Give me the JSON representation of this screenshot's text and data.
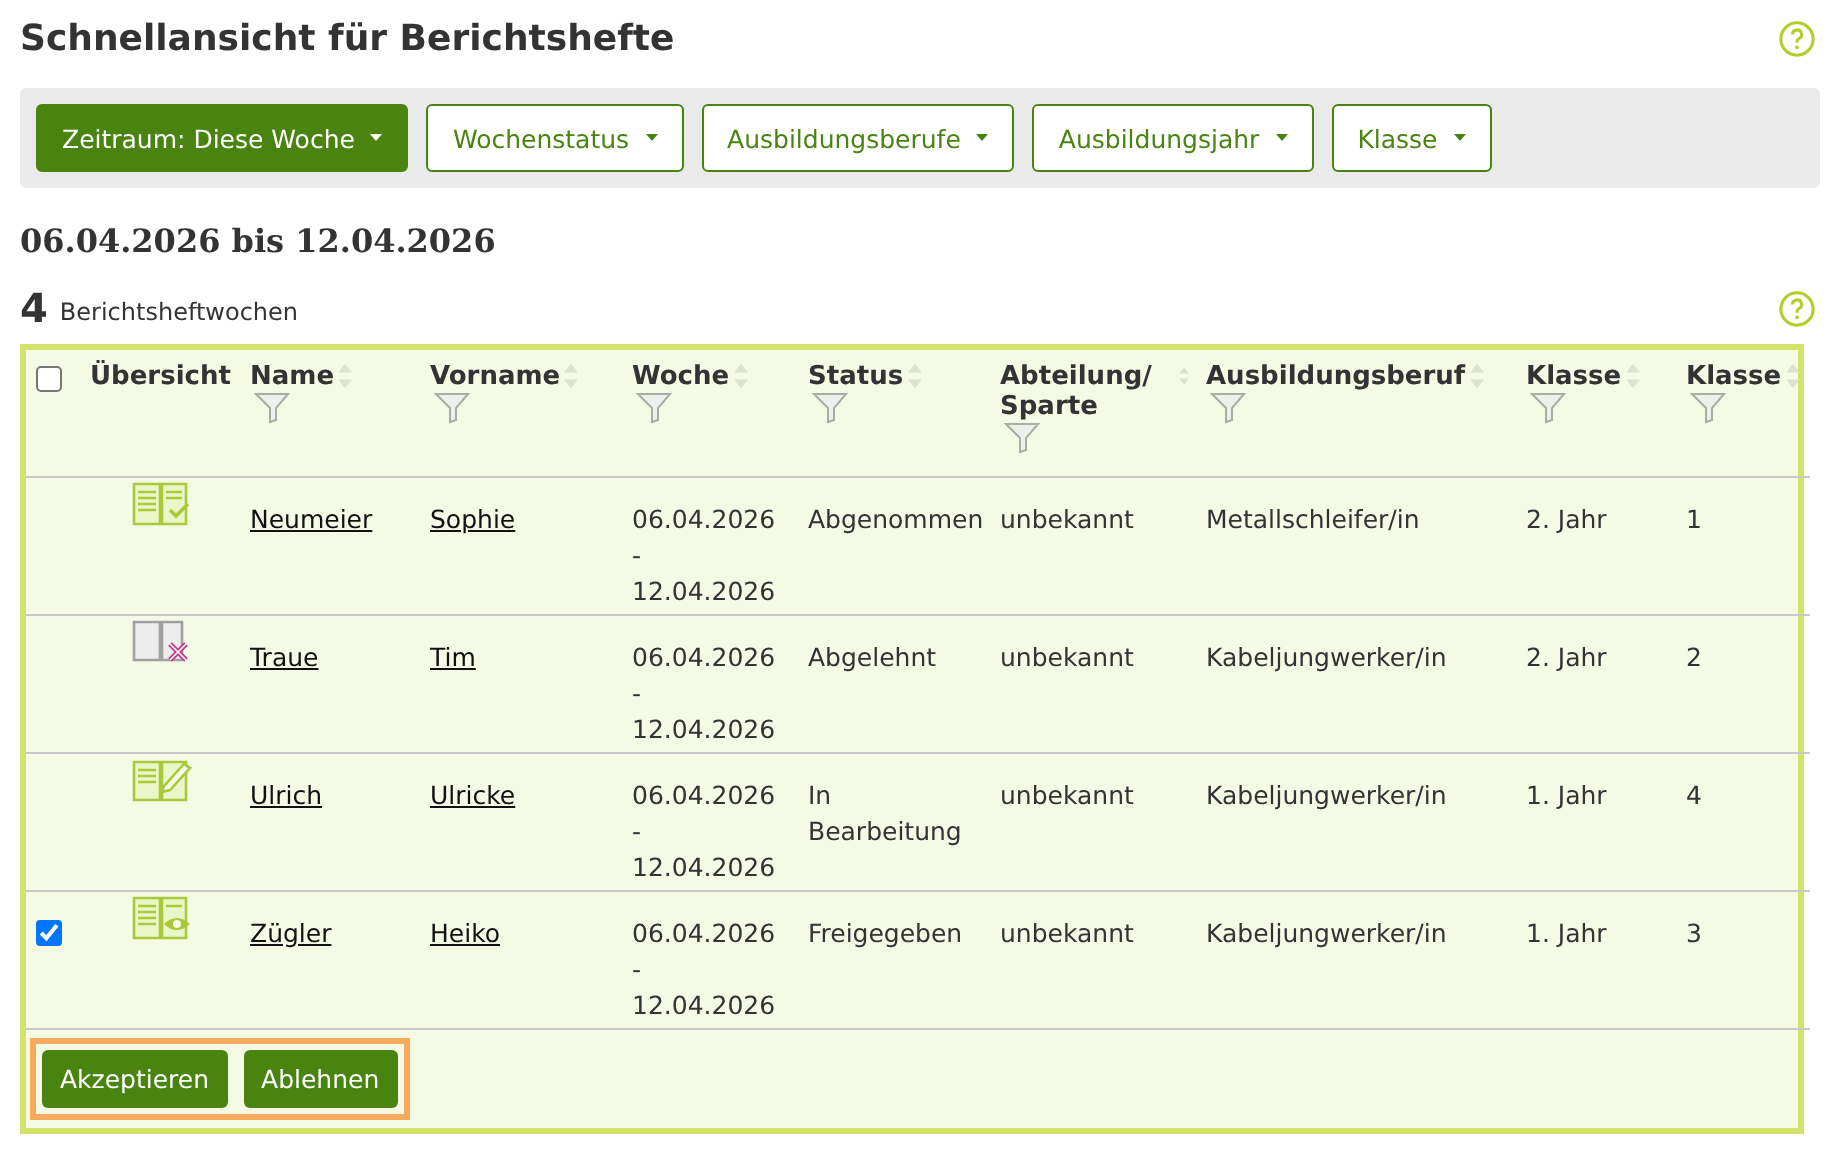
{
  "title": "Schnellansicht für Berichtshefte",
  "filters": [
    {
      "label": "Zeitraum: Diese Woche",
      "selected": true
    },
    {
      "label": "Wochenstatus",
      "selected": false
    },
    {
      "label": "Ausbildungsberufe",
      "selected": false
    },
    {
      "label": "Ausbildungsjahr",
      "selected": false
    },
    {
      "label": "Klasse",
      "selected": false
    }
  ],
  "date_range": "06.04.2026 bis 12.04.2026",
  "count": "4",
  "count_label": "Berichtsheftwochen",
  "table": {
    "select_all_checked": false,
    "columns": [
      {
        "label": "Übersicht",
        "kind": "plain"
      },
      {
        "label": "Name",
        "kind": "sortable"
      },
      {
        "label": "Vorname",
        "kind": "sortable"
      },
      {
        "label": "Woche",
        "kind": "sortable"
      },
      {
        "label": "Status",
        "kind": "sortable"
      },
      {
        "label": "Abteilung/ Sparte",
        "kind": "sortable"
      },
      {
        "label": "Ausbildungsberuf",
        "kind": "sortable"
      },
      {
        "label": "Klasse",
        "kind": "sortable"
      },
      {
        "label": "Klasse",
        "kind": "sortable"
      }
    ],
    "rows": [
      {
        "checked": false,
        "kind": "accepted",
        "name": "Neumeier",
        "vorname": "Sophie",
        "woche": "06.04.2026 - 12.04.2026",
        "status": "Abgenommen",
        "abteilung": "unbekannt",
        "beruf": "Metallschleifer/in",
        "jahr": "2. Jahr",
        "klasse": "1"
      },
      {
        "checked": false,
        "kind": "rejected",
        "name": "Traue",
        "vorname": "Tim",
        "woche": "06.04.2026 - 12.04.2026",
        "status": "Abgelehnt",
        "abteilung": "unbekannt",
        "beruf": "Kabeljungwerker/in",
        "jahr": "2. Jahr",
        "klasse": "2"
      },
      {
        "checked": false,
        "kind": "editing",
        "name": "Ulrich",
        "vorname": "Ulricke",
        "woche": "06.04.2026 - 12.04.2026",
        "status": "In Bearbeitung",
        "abteilung": "unbekannt",
        "beruf": "Kabeljungwerker/in",
        "jahr": "1. Jahr",
        "klasse": "4"
      },
      {
        "checked": true,
        "kind": "released",
        "name": "Zügler",
        "vorname": "Heiko",
        "woche": "06.04.2026 - 12.04.2026",
        "status": "Freigegeben",
        "abteilung": "unbekannt",
        "beruf": "Kabeljungwerker/in",
        "jahr": "1. Jahr",
        "klasse": "3"
      }
    ]
  },
  "actions": [
    "Akzeptieren",
    "Ablehnen"
  ]
}
